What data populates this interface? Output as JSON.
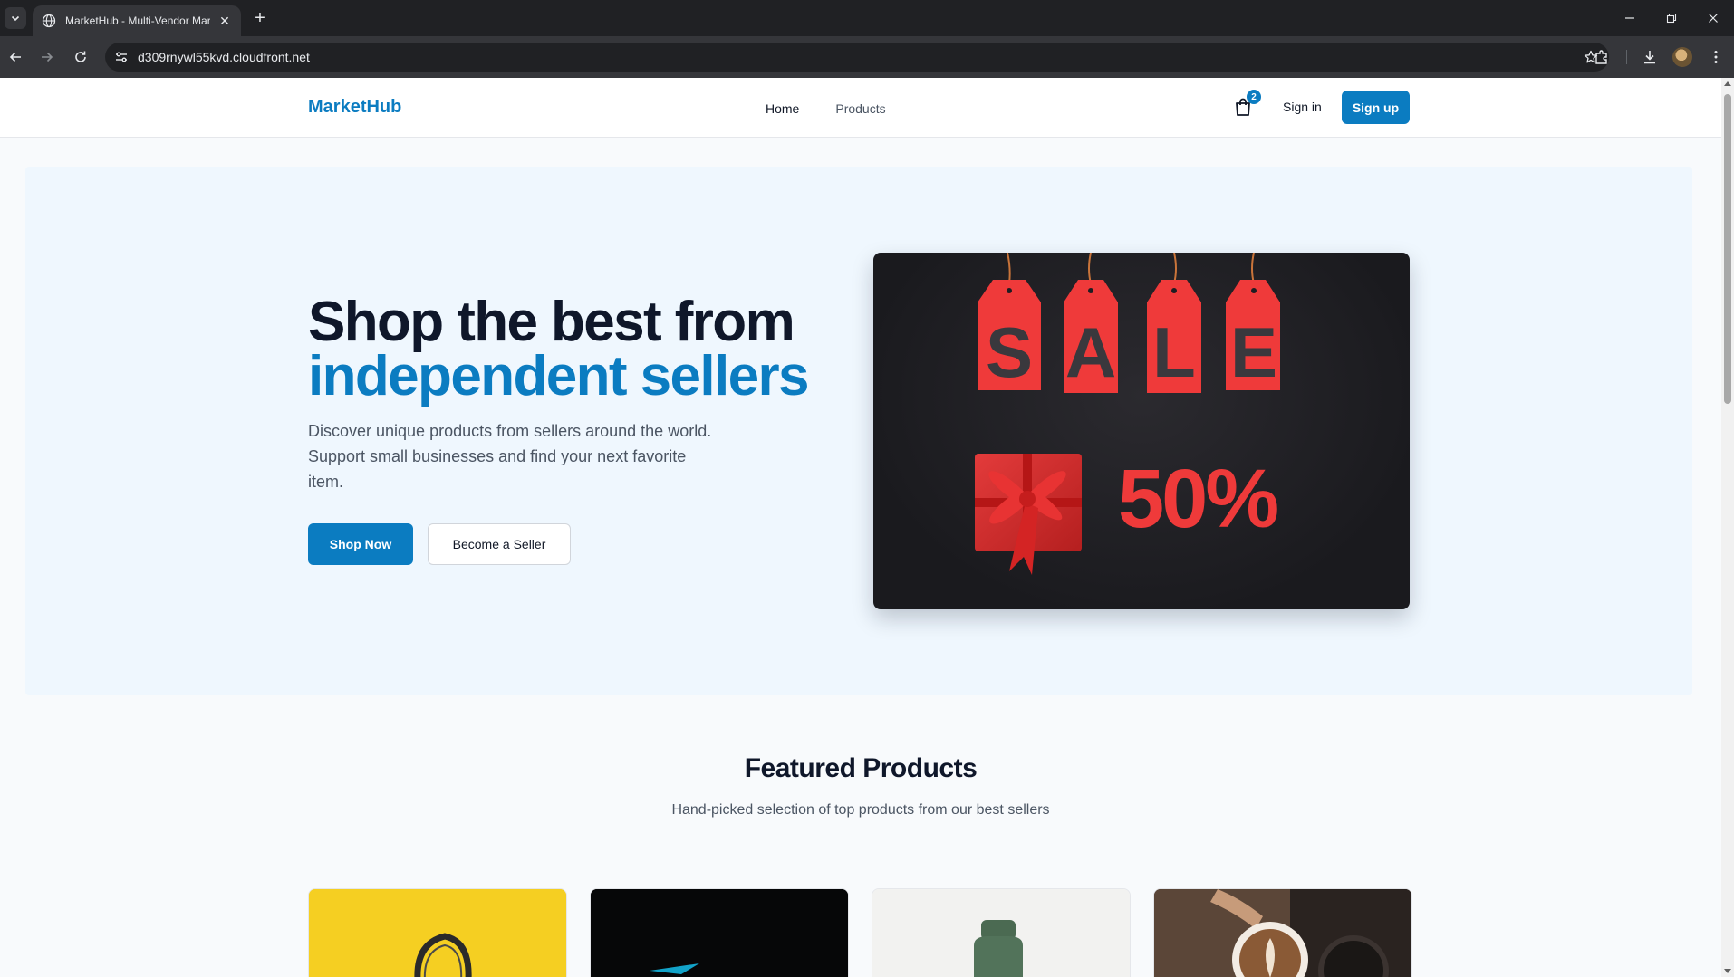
{
  "browser": {
    "tab_title": "MarketHub - Multi-Vendor Marketplace",
    "url": "d309rnywl55kvd.cloudfront.net"
  },
  "header": {
    "logo": "MarketHub",
    "nav": [
      "Home",
      "Products"
    ],
    "cart_count": "2",
    "signin_label": "Sign in",
    "signup_label": "Sign up"
  },
  "hero": {
    "title_line1": "Shop the best from",
    "title_line2": "independent sellers",
    "subtitle": "Discover unique products from sellers around the world. Support small businesses and find your next favorite item.",
    "primary_cta": "Shop Now",
    "secondary_cta": "Become a Seller",
    "image": {
      "tags": [
        "S",
        "A",
        "L",
        "E"
      ],
      "discount": "50%"
    }
  },
  "featured": {
    "title": "Featured Products",
    "subtitle": "Hand-picked selection of top products from our best sellers",
    "cards": [
      {
        "name": "headphones-thumbnail",
        "bg": "#f7d428"
      },
      {
        "name": "dark-product-thumbnail",
        "bg": "#050607"
      },
      {
        "name": "bottle-thumbnail",
        "bg": "#f3f3f1"
      },
      {
        "name": "coffee-thumbnail",
        "bg": "#4a3a30"
      }
    ]
  },
  "colors": {
    "brand": "#0b7cc1",
    "hero_bg": "#eff7fe",
    "sale_red": "#ef3a3a"
  }
}
